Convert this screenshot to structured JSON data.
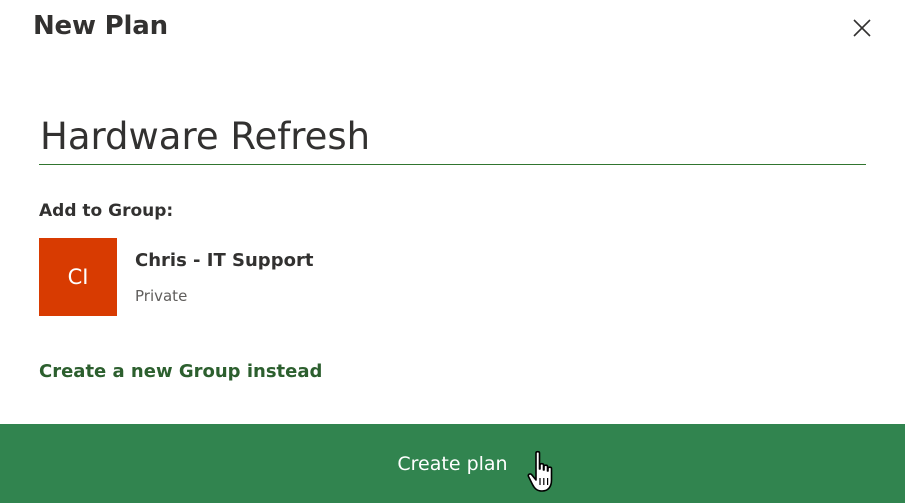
{
  "dialog": {
    "title": "New Plan",
    "close_icon": "close-icon"
  },
  "plan": {
    "name_value": "Hardware Refresh"
  },
  "group": {
    "section_label": "Add to Group:",
    "avatar_initials": "CI",
    "avatar_color": "#d83b01",
    "name": "Chris - IT Support",
    "privacy": "Private"
  },
  "links": {
    "new_group": "Create a new Group instead"
  },
  "footer": {
    "create_label": "Create plan",
    "button_color": "#31844f"
  },
  "cursor": {
    "icon": "hand-pointer-icon"
  }
}
